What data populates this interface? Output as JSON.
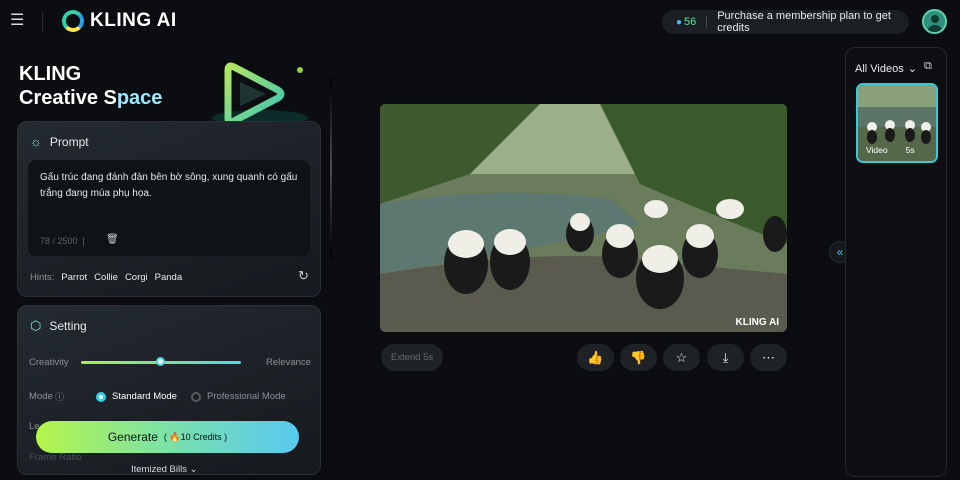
{
  "header": {
    "brand": "KLING AI",
    "credits": "56",
    "membership_text": "Purchase a membership plan to get credits"
  },
  "hero": {
    "line1": "KLING",
    "line2a": "Creative S",
    "line2b": "pace"
  },
  "prompt": {
    "title": "Prompt",
    "text": "Gấu trúc đang đánh đàn bên bờ sông, xung quanh có gấu trắng đang múa phụ họa.",
    "count": "78 / 2500",
    "hints_label": "Hints:",
    "hints": [
      "Parrot",
      "Collie",
      "Corgi",
      "Panda"
    ]
  },
  "setting": {
    "title": "Setting",
    "creativity_label": "Creativity",
    "relevance_label": "Relevance",
    "slider_value": 0.5,
    "mode_label": "Mode",
    "mode_standard": "Standard Mode",
    "mode_professional": "Professional Mode",
    "len_label": "Le",
    "ratio_label": "Frame Ratio"
  },
  "generate": {
    "label": "Generate",
    "credits": "10 Credits",
    "itemized": "Itemized Bills"
  },
  "video": {
    "watermark": "KLING AI",
    "extend_label": "Extend 5s"
  },
  "rail": {
    "title": "All Videos",
    "thumb_type": "Video",
    "thumb_duration": "5s"
  }
}
